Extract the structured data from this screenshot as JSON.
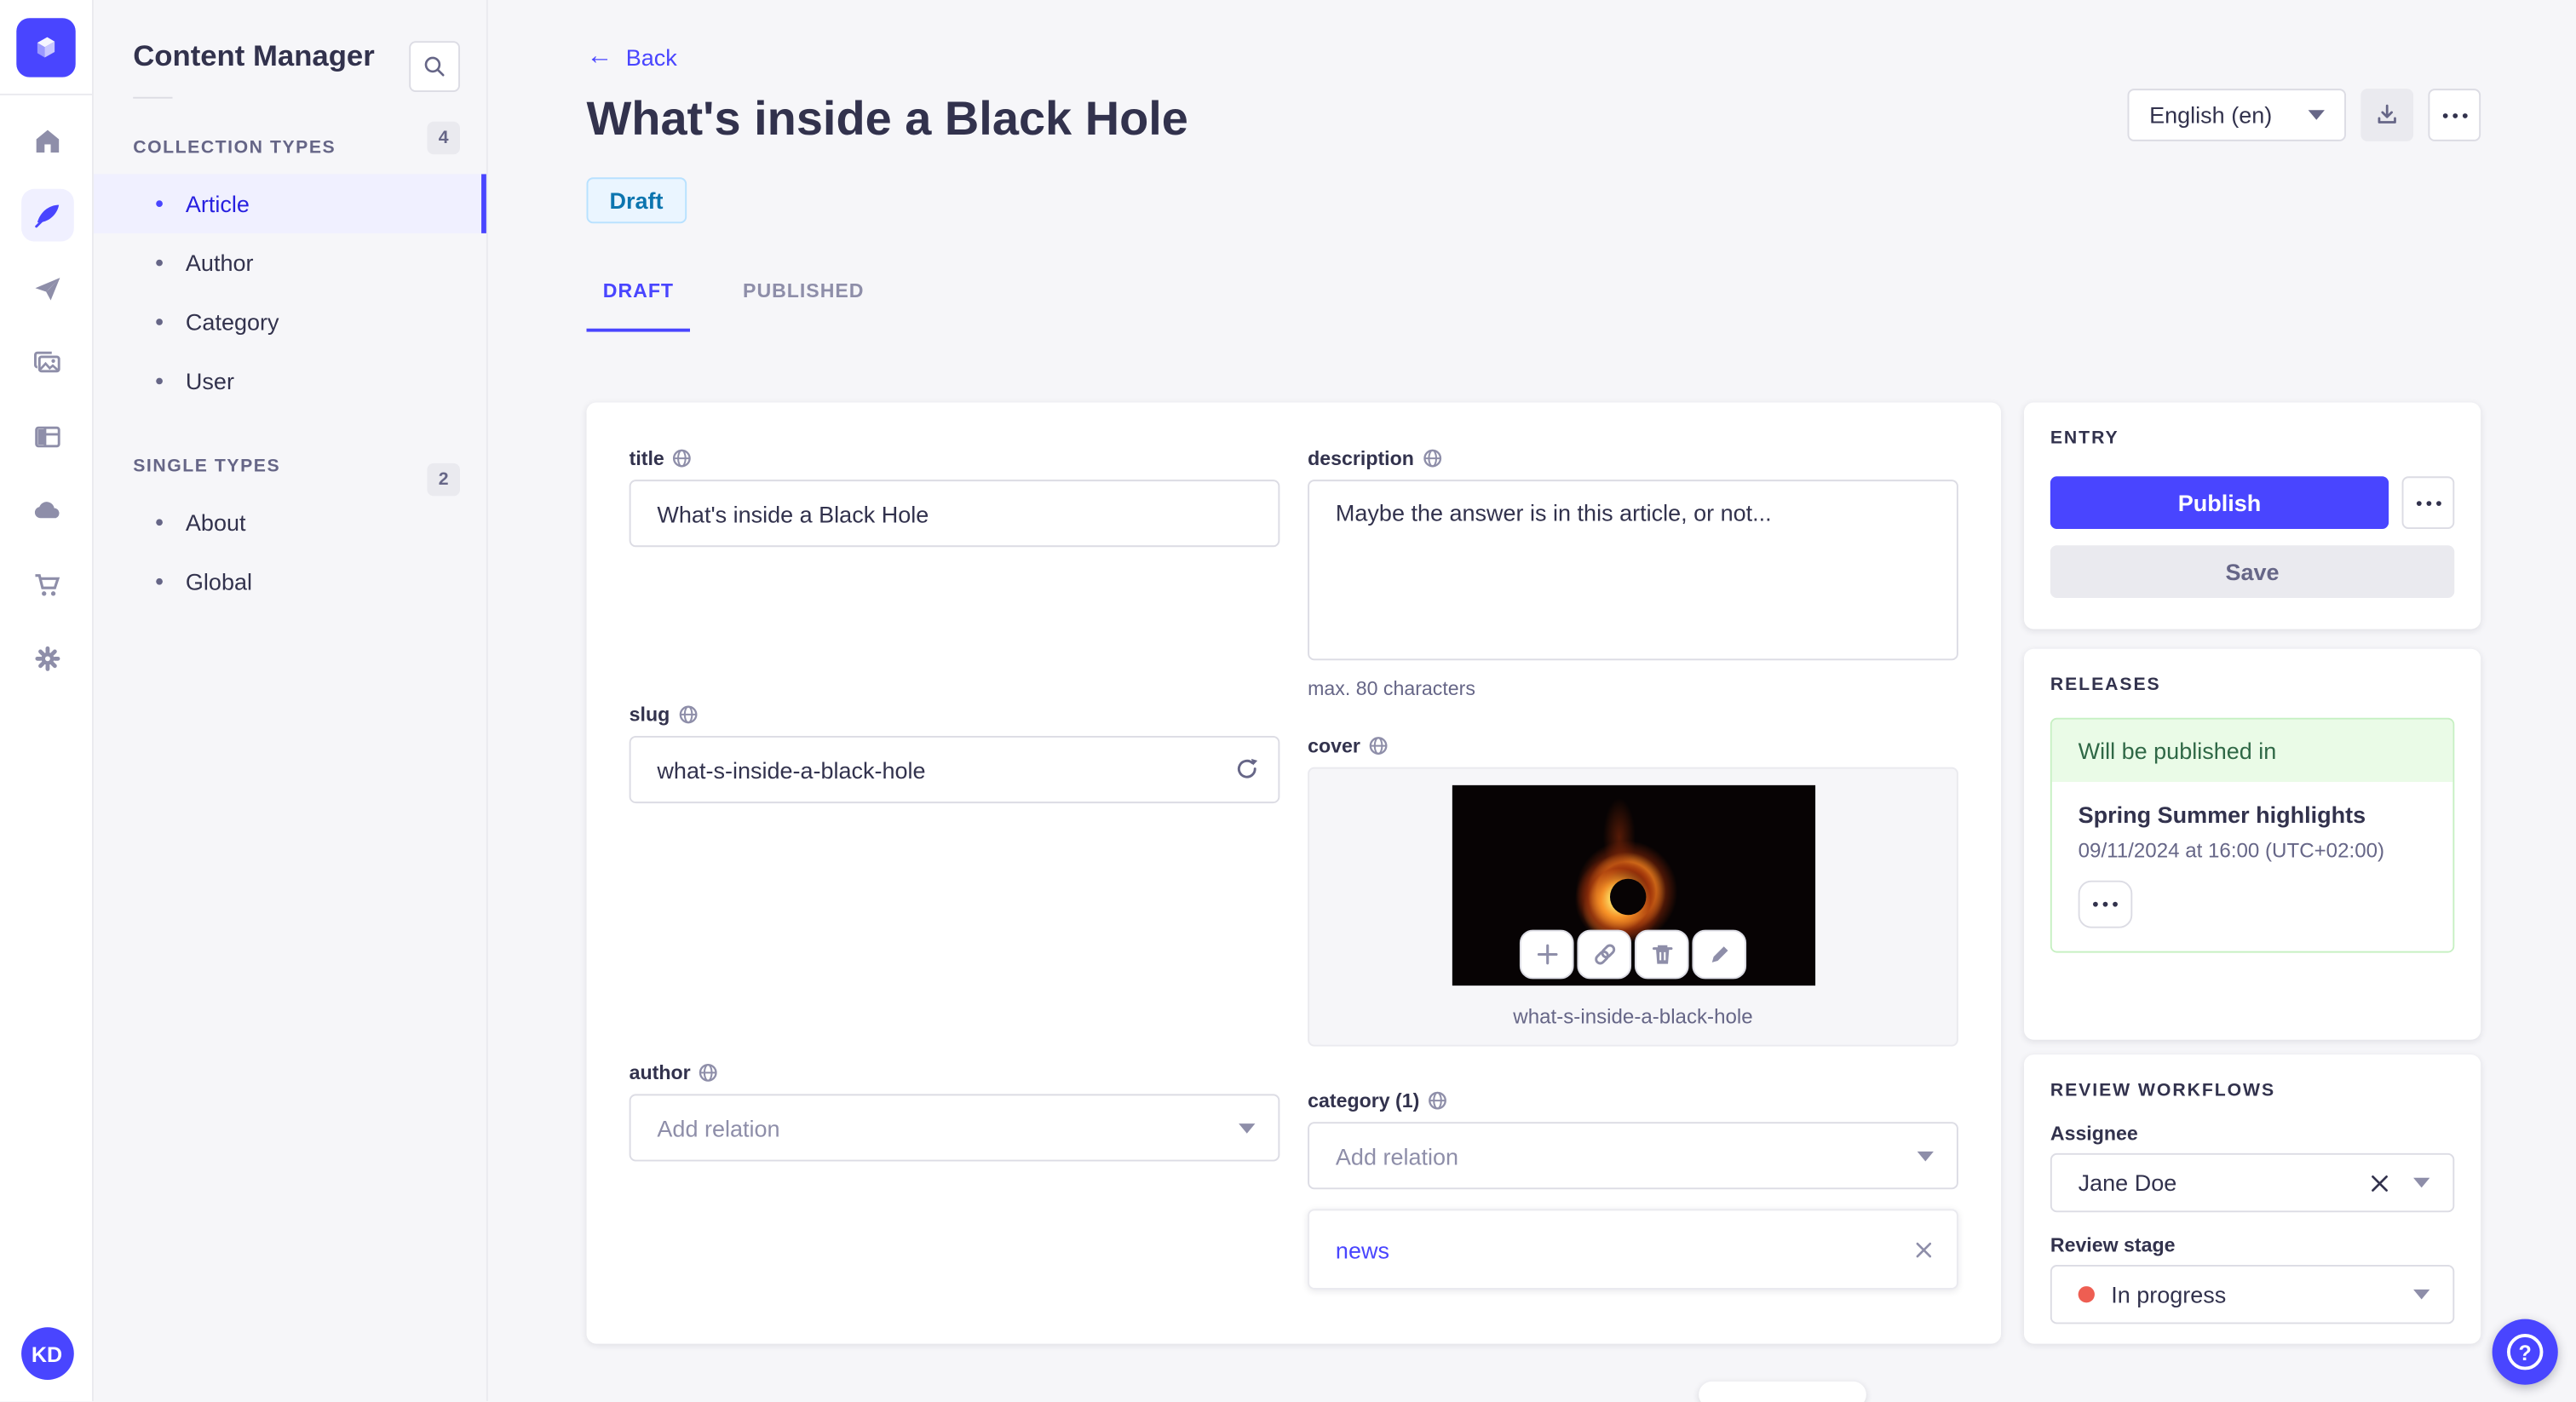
{
  "colors": {
    "primary": "#4945ff",
    "active_nav_text": "#271fe0",
    "draft_badge_bg": "#eaf5ff",
    "draft_badge_text": "#0c75af",
    "release_green_bg": "#eafbe7",
    "release_green_text": "#2f6846",
    "stage_dot": "#ee5e52"
  },
  "iconbar": {
    "avatar_initials": "KD",
    "icons": [
      "strapi-logo",
      "home",
      "content-manager-feather",
      "releases-send",
      "media-library",
      "content-type-builder",
      "cloud",
      "marketplace-cart",
      "settings-gear"
    ]
  },
  "subnav": {
    "title": "Content Manager",
    "sections": [
      {
        "label": "COLLECTION TYPES",
        "count": "4",
        "items": [
          {
            "label": "Article"
          },
          {
            "label": "Author"
          },
          {
            "label": "Category"
          },
          {
            "label": "User"
          }
        ]
      },
      {
        "label": "SINGLE TYPES",
        "count": "2",
        "items": [
          {
            "label": "About"
          },
          {
            "label": "Global"
          }
        ]
      }
    ]
  },
  "header": {
    "back_label": "Back",
    "title": "What's inside a Black Hole",
    "status_badge": "Draft",
    "locale_selector": "English (en)",
    "tabs": [
      {
        "label": "DRAFT"
      },
      {
        "label": "PUBLISHED"
      }
    ]
  },
  "form": {
    "title": {
      "label": "title",
      "value": "What's inside a Black Hole"
    },
    "description": {
      "label": "description",
      "value": "Maybe the answer is in this article, or not...",
      "hint": "max. 80 characters"
    },
    "slug": {
      "label": "slug",
      "value": "what-s-inside-a-black-hole"
    },
    "cover": {
      "label": "cover",
      "caption": "what-s-inside-a-black-hole"
    },
    "author": {
      "label": "author",
      "placeholder": "Add relation"
    },
    "category": {
      "label": "category (1)",
      "placeholder": "Add relation",
      "relations": [
        {
          "label": "news"
        }
      ]
    }
  },
  "entry_panel": {
    "title": "ENTRY",
    "publish_label": "Publish",
    "save_label": "Save"
  },
  "releases_panel": {
    "title": "RELEASES",
    "status": "Will be published in",
    "release_name": "Spring Summer highlights",
    "release_date": "09/11/2024 at 16:00 (UTC+02:00)"
  },
  "review_panel": {
    "title": "REVIEW WORKFLOWS",
    "assignee_label": "Assignee",
    "assignee_value": "Jane Doe",
    "stage_label": "Review stage",
    "stage_value": "In progress"
  },
  "fab": {
    "help_glyph": "?"
  }
}
